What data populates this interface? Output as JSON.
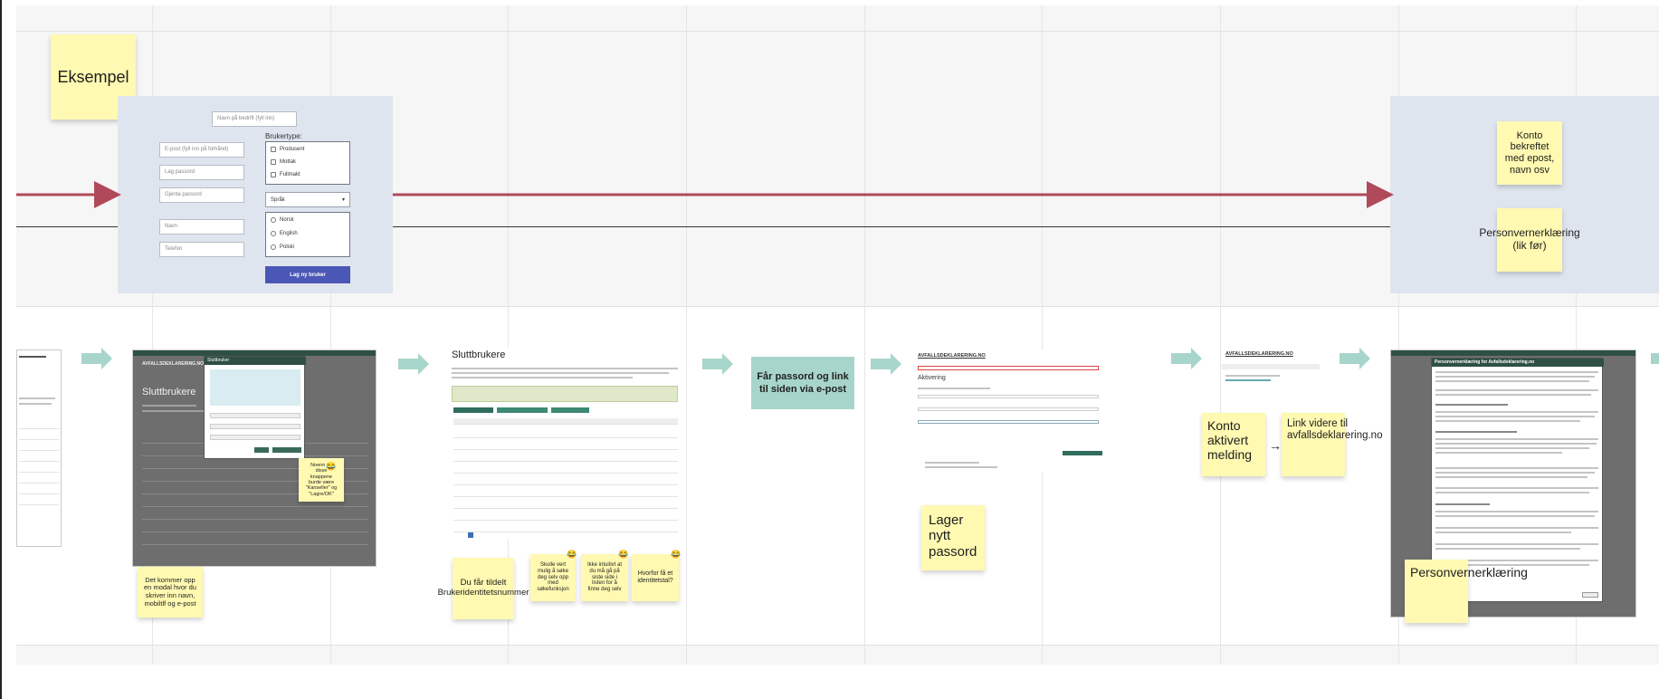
{
  "row1": {
    "example_note": "Eksempel",
    "form": {
      "name_placeholder": "Navn på bedrift (fyll inn)",
      "email_placeholder": "E-post (fyll inn på forhånd)",
      "password_placeholder": "Lag passord",
      "repeat_password_placeholder": "Gjenta passord",
      "name_field_placeholder": "Navn",
      "phone_placeholder": "Telefon",
      "usertype_label": "Brukertype:",
      "usertypes": [
        "Produsent",
        "Mottak",
        "Fullmakt"
      ],
      "language_select": "Språk",
      "languages": [
        "Norsk",
        "English",
        "Polski"
      ],
      "submit_label": "Lag ny bruker"
    },
    "note_account_confirmed": "Konto bekreftet med epost, navn osv",
    "note_privacy_declaration": "Personvernerklæring (lik før)"
  },
  "row2": {
    "screen_brand": "AVFALLSDEKLARERING.NO",
    "screen_title_sluttbrukere": "Sluttbrukere",
    "modal_title": "Sluttbruker",
    "note_modal": "Det kommer opp en modal hvor du skriver inn navn, mobiltlf og e-post",
    "note_buttons": "Noenn på disse knappene burde være \"Kanseller\" og \"Lagre/OK\"",
    "note_user_id": "Du får tildelt Brukeridentitetsnummer",
    "note_edit_self": "Skulle vert mulig å søke deg selv opp med søkefunksjon",
    "note_intuitive": "Ikke intuitivt at du må gå på siste side i listen for å finne deg selv",
    "note_why_id": "Hvorfor få et identitetstal?",
    "teal_password_link": "Får passord og link til siden via e-post",
    "screen_title_aktivering": "Aktivering",
    "note_new_password": "Lager nytt passord",
    "note_account_activated": "Konto aktivert melding",
    "note_link_further": "Link videre til avfallsdeklarering.no",
    "arrow_glyph": "→",
    "note_privacy": "Personvernerklæring",
    "privacy_modal_title": "Personvernerklæring for Avfallsdeklarering.no"
  },
  "colors": {
    "flow_arrow": "#b04a5a",
    "teal_arrow": "#a8d5cb",
    "sticky": "#fff9b1",
    "panel": "#dfe5ee",
    "primary": "#4a57b7"
  }
}
